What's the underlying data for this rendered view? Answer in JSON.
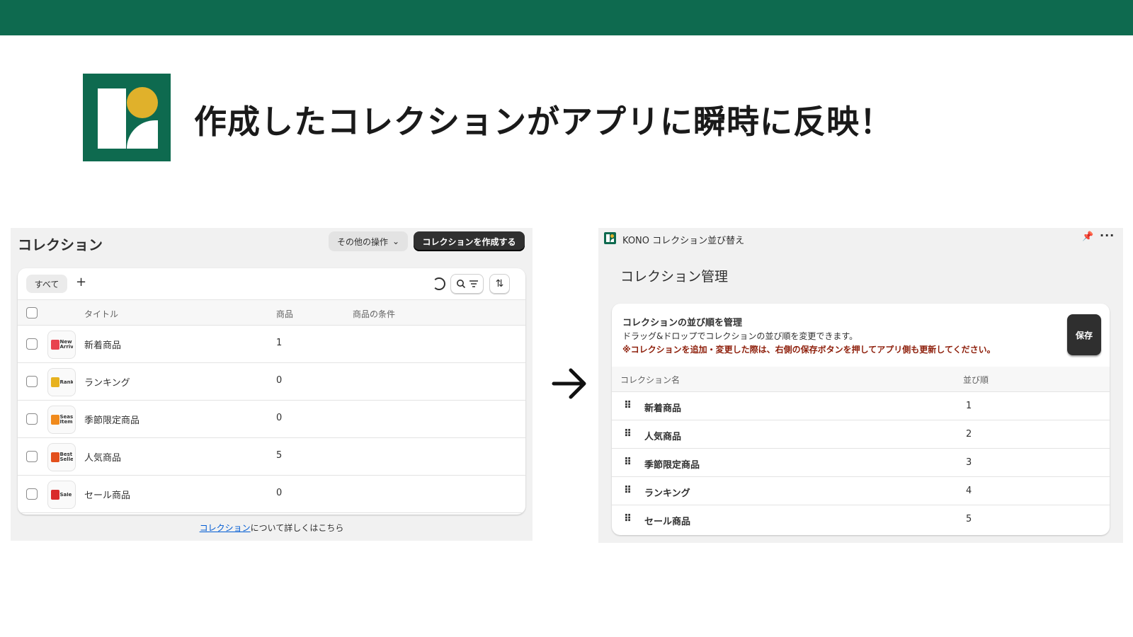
{
  "headline": "作成したコレクションがアプリに瞬時に反映！",
  "colors": {
    "brand_green": "#0e6a4f",
    "brand_yellow": "#e0b12b",
    "warning_red": "#8e1f0b"
  },
  "left_panel": {
    "title": "コレクション",
    "other_actions_label": "その他の操作",
    "create_label": "コレクションを作成する",
    "tab_all": "すべて",
    "tab_add": "+",
    "columns": {
      "title": "タイトル",
      "products": "商品",
      "conditions": "商品の条件"
    },
    "rows": [
      {
        "title": "新着商品",
        "count": "1",
        "thumb_text": "New Arrivals",
        "thumb_color": "#e8434f"
      },
      {
        "title": "ランキング",
        "count": "0",
        "thumb_text": "Ranking",
        "thumb_color": "#e7b21f"
      },
      {
        "title": "季節限定商品",
        "count": "0",
        "thumb_text": "Seasonal Items",
        "thumb_color": "#f08a1c"
      },
      {
        "title": "人気商品",
        "count": "5",
        "thumb_text": "Best Sellers",
        "thumb_color": "#e3501c"
      },
      {
        "title": "セール商品",
        "count": "0",
        "thumb_text": "Sale",
        "thumb_color": "#d92b2b"
      }
    ],
    "footer_link": "コレクション",
    "footer_text": "について詳しくはこちら"
  },
  "right_panel": {
    "app_name": "KONO コレクション並び替え",
    "page_title": "コレクション管理",
    "card_title": "コレクションの並び順を管理",
    "card_desc": "ドラッグ&ドロップでコレクションの並び順を変更できます。",
    "card_warning": "※コレクションを追加・変更した際は、右側の保存ボタンを押してアプリ側も更新してください。",
    "save_label": "保存",
    "columns": {
      "name": "コレクション名",
      "order": "並び順"
    },
    "rows": [
      {
        "name": "新着商品",
        "order": "1"
      },
      {
        "name": "人気商品",
        "order": "2"
      },
      {
        "name": "季節限定商品",
        "order": "3"
      },
      {
        "name": "ランキング",
        "order": "4"
      },
      {
        "name": "セール商品",
        "order": "5"
      }
    ]
  }
}
